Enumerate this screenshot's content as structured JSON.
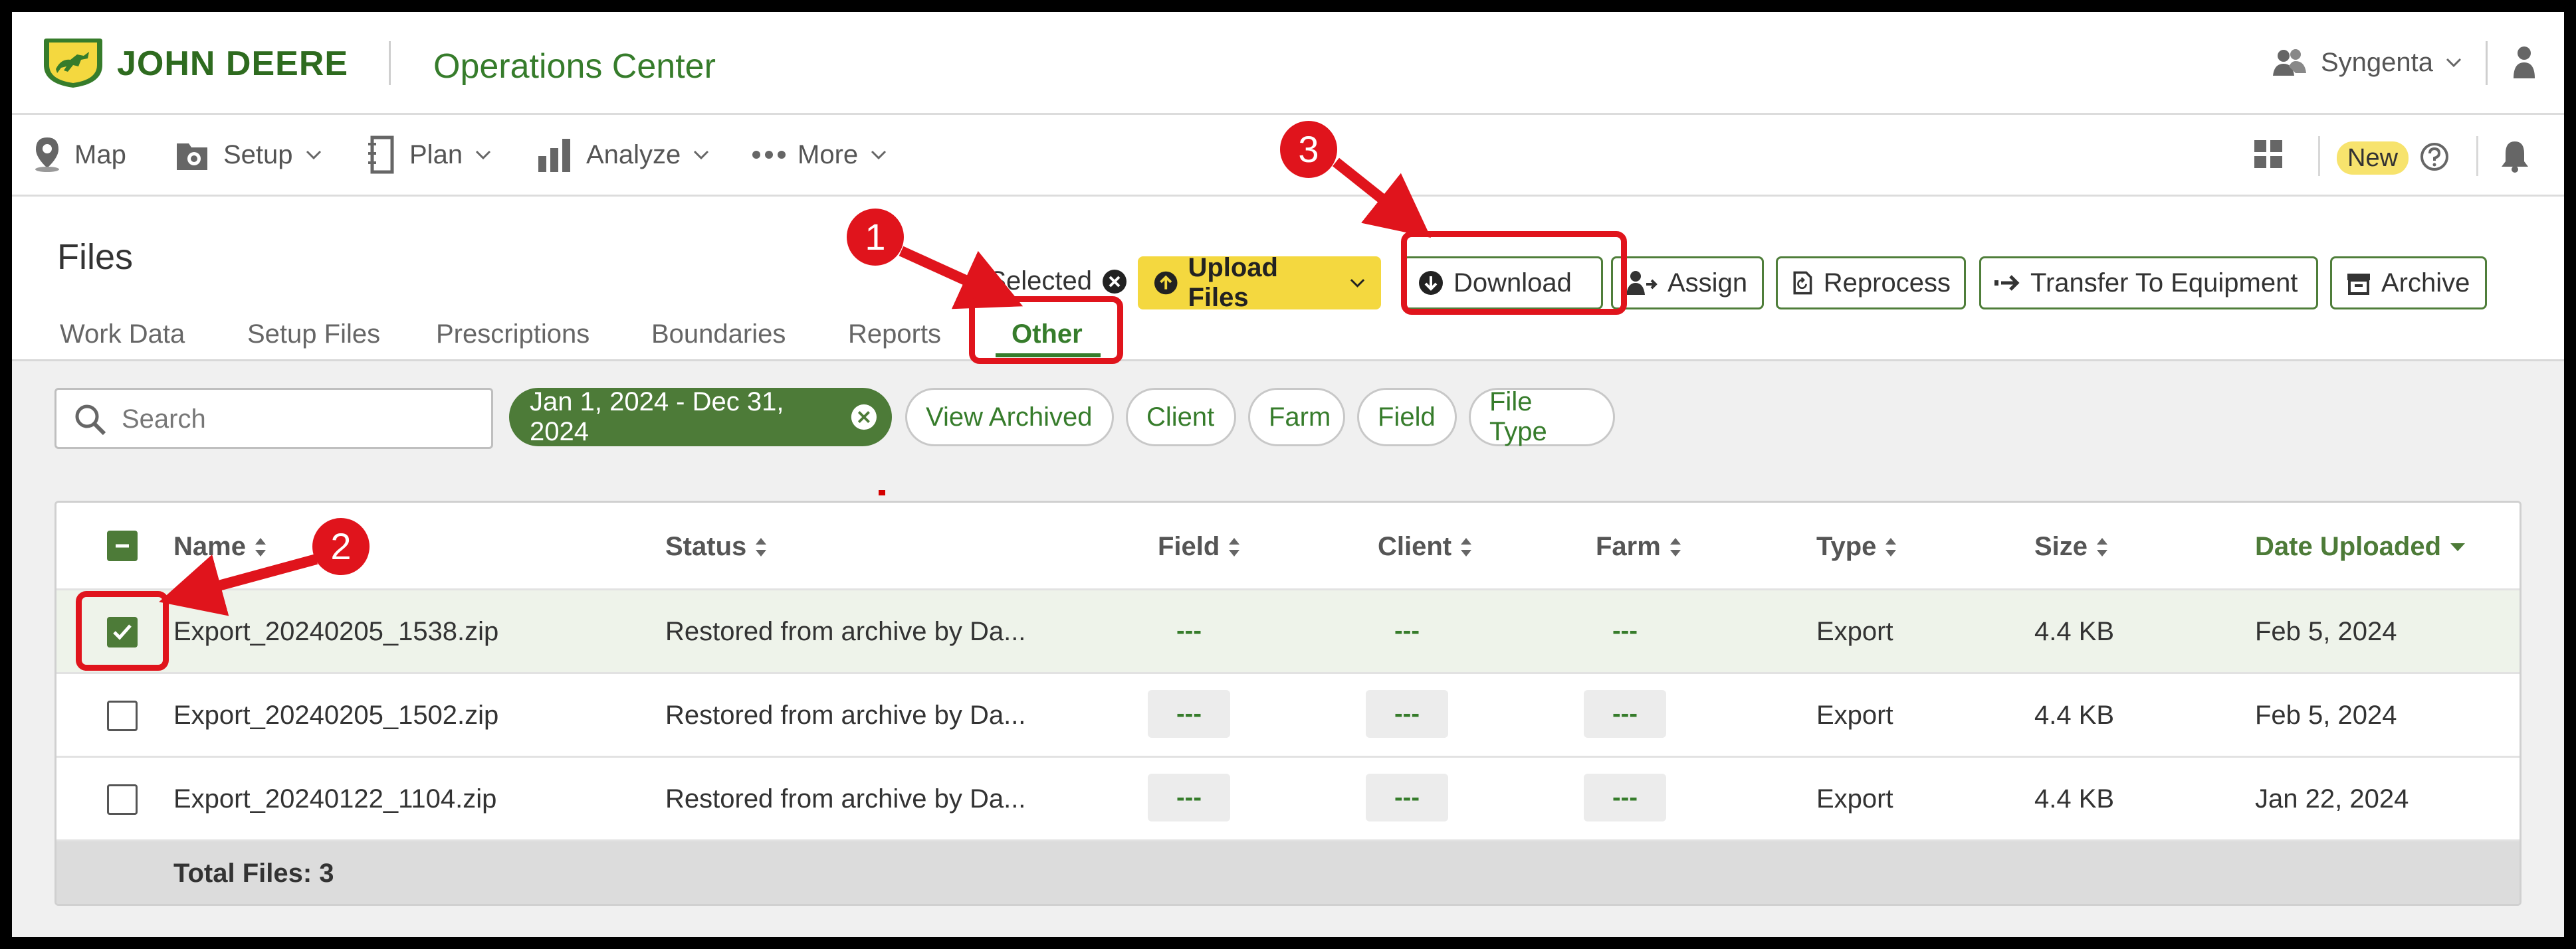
{
  "header": {
    "brand": "JOHN DEERE",
    "app_title": "Operations Center",
    "org_name": "Syngenta"
  },
  "nav": {
    "items": [
      {
        "label": "Map",
        "icon": "map-pin-icon"
      },
      {
        "label": "Setup",
        "icon": "setup-icon"
      },
      {
        "label": "Plan",
        "icon": "plan-icon"
      },
      {
        "label": "Analyze",
        "icon": "analyze-icon"
      },
      {
        "label": "More",
        "icon": "more-icon"
      }
    ],
    "new_badge": "New"
  },
  "files": {
    "title": "Files",
    "tabs": [
      "Work Data",
      "Setup Files",
      "Prescriptions",
      "Boundaries",
      "Reports",
      "Other"
    ],
    "active_tab": "Other",
    "selected_text": "1 Selected",
    "actions": {
      "upload": "Upload Files",
      "download": "Download",
      "assign": "Assign",
      "reprocess": "Reprocess",
      "transfer": "Transfer To Equipment",
      "archive": "Archive"
    }
  },
  "filters": {
    "search_placeholder": "Search",
    "date_range": "Jan 1, 2024 - Dec 31, 2024",
    "chips": [
      "View Archived",
      "Client",
      "Farm",
      "Field",
      "File Type"
    ]
  },
  "table": {
    "columns": [
      "Name",
      "Status",
      "Field",
      "Client",
      "Farm",
      "Type",
      "Size",
      "Date Uploaded"
    ],
    "sorted_column": "Date Uploaded",
    "rows": [
      {
        "name": "Export_20240205_1538.zip",
        "status": "Restored from archive by Da...",
        "field": "---",
        "client": "---",
        "farm": "---",
        "type": "Export",
        "size": "4.4 KB",
        "date": "Feb 5, 2024",
        "checked": true
      },
      {
        "name": "Export_20240205_1502.zip",
        "status": "Restored from archive by Da...",
        "field": "---",
        "client": "---",
        "farm": "---",
        "type": "Export",
        "size": "4.4 KB",
        "date": "Feb 5, 2024",
        "checked": false
      },
      {
        "name": "Export_20240122_1104.zip",
        "status": "Restored from archive by Da...",
        "field": "---",
        "client": "---",
        "farm": "---",
        "type": "Export",
        "size": "4.4 KB",
        "date": "Jan 22, 2024",
        "checked": false
      }
    ],
    "footer": "Total Files: 3"
  },
  "annotations": {
    "step1": "1",
    "step2": "2",
    "step3": "3",
    "color": "#e0141c"
  },
  "colors": {
    "brand_green": "#367c2b",
    "brand_yellow": "#f4d83f",
    "chip_green": "#4d7b38"
  }
}
